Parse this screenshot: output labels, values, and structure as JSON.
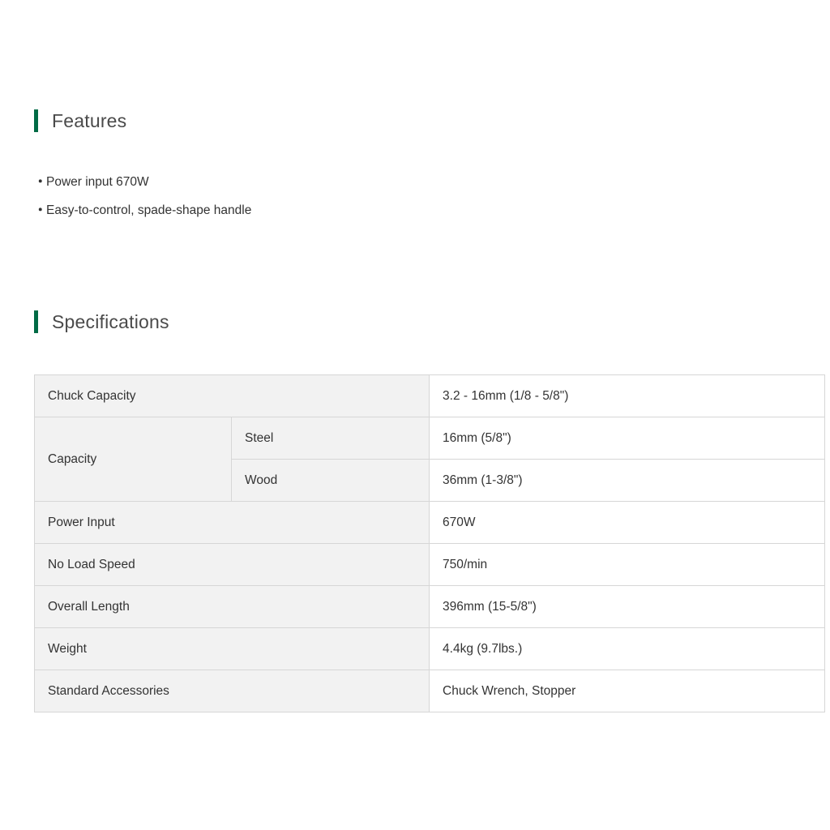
{
  "features": {
    "heading": "Features",
    "bullet": "・",
    "items": [
      "Power input 670W",
      "Easy-to-control, spade-shape handle"
    ]
  },
  "specifications": {
    "heading": "Specifications",
    "rows": {
      "chuck_capacity": {
        "label": "Chuck Capacity",
        "value": "3.2 - 16mm (1/8 - 5/8\")"
      },
      "capacity": {
        "label": "Capacity",
        "steel": {
          "label": "Steel",
          "value": "16mm (5/8\")"
        },
        "wood": {
          "label": "Wood",
          "value": "36mm (1-3/8\")"
        }
      },
      "power_input": {
        "label": "Power Input",
        "value": "670W"
      },
      "no_load_speed": {
        "label": "No Load Speed",
        "value": "750/min"
      },
      "overall_length": {
        "label": "Overall Length",
        "value": "396mm (15-5/8\")"
      },
      "weight": {
        "label": "Weight",
        "value": "4.4kg (9.7lbs.)"
      },
      "standard_accessories": {
        "label": "Standard Accessories",
        "value": "Chuck Wrench, Stopper"
      }
    }
  },
  "colors": {
    "accent": "#006b45",
    "label_background": "#f2f2f2",
    "border": "#d6d6d6"
  }
}
